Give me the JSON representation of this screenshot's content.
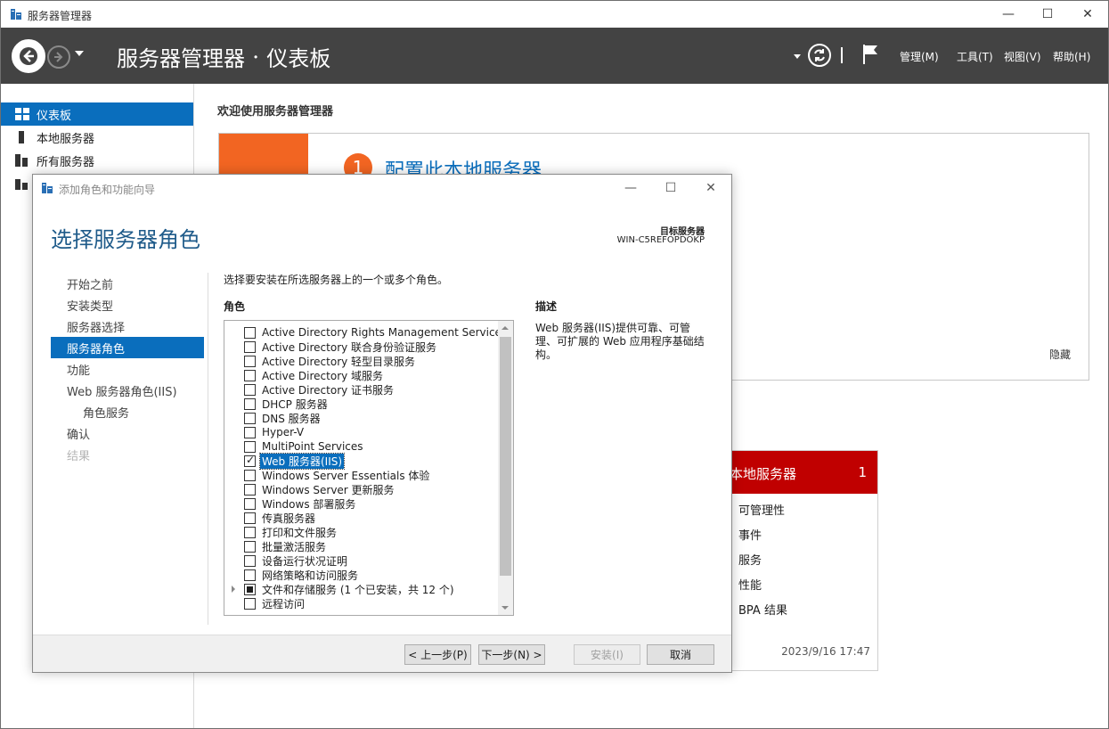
{
  "window": {
    "title": "服务器管理器",
    "minimize": "—",
    "maximize": "☐",
    "close": "✕"
  },
  "header": {
    "breadcrumb_root": "服务器管理器",
    "breadcrumb_sep": "•",
    "breadcrumb_current": "仪表板",
    "menus": [
      "管理(M)",
      "工具(T)",
      "视图(V)",
      "帮助(H)"
    ]
  },
  "nav": {
    "items": [
      {
        "label": "仪表板",
        "icon": "dashboard-icon",
        "active": true
      },
      {
        "label": "本地服务器",
        "icon": "server-icon"
      },
      {
        "label": "所有服务器",
        "icon": "servers-icon"
      }
    ]
  },
  "dashboard": {
    "title": "欢迎使用服务器管理器",
    "step_number": "1",
    "step_text": "配置此本地服务器",
    "hide_label": "隐藏",
    "tile": {
      "name": "本地服务器",
      "count": "1",
      "lines": [
        "可管理性",
        "事件",
        "服务",
        "性能",
        "BPA 结果"
      ],
      "timestamp": "2023/9/16 17:47"
    }
  },
  "wizard": {
    "title": "添加角色和功能向导",
    "heading": "选择服务器角色",
    "dest_label": "目标服务器",
    "dest_value": "WIN-C5REFOPDOKP",
    "steps": [
      {
        "label": "开始之前"
      },
      {
        "label": "安装类型"
      },
      {
        "label": "服务器选择"
      },
      {
        "label": "服务器角色",
        "active": true
      },
      {
        "label": "功能"
      },
      {
        "label": "Web 服务器角色(IIS)"
      },
      {
        "label": "角色服务",
        "indent": true
      },
      {
        "label": "确认"
      },
      {
        "label": "结果",
        "disabled": true
      }
    ],
    "instruction": "选择要安装在所选服务器上的一个或多个角色。",
    "roles_label": "角色",
    "roles": [
      {
        "label": "Active Directory Rights Management Services"
      },
      {
        "label": "Active Directory 联合身份验证服务"
      },
      {
        "label": "Active Directory 轻型目录服务"
      },
      {
        "label": "Active Directory 域服务"
      },
      {
        "label": "Active Directory 证书服务"
      },
      {
        "label": "DHCP 服务器"
      },
      {
        "label": "DNS 服务器"
      },
      {
        "label": "Hyper-V"
      },
      {
        "label": "MultiPoint Services"
      },
      {
        "label": "Web 服务器(IIS)",
        "checked": true,
        "selected": true
      },
      {
        "label": "Windows Server Essentials 体验"
      },
      {
        "label": "Windows Server 更新服务"
      },
      {
        "label": "Windows 部署服务"
      },
      {
        "label": "传真服务器"
      },
      {
        "label": "打印和文件服务"
      },
      {
        "label": "批量激活服务"
      },
      {
        "label": "设备运行状况证明"
      },
      {
        "label": "网络策略和访问服务"
      },
      {
        "label": "文件和存储服务 (1 个已安装，共 12 个)",
        "partial": true,
        "expandable": true
      },
      {
        "label": "远程访问"
      }
    ],
    "desc_label": "描述",
    "desc_text": "Web 服务器(IIS)提供可靠、可管理、可扩展的 Web 应用程序基础结构。",
    "buttons": {
      "prev": "< 上一步(P)",
      "next": "下一步(N) >",
      "install": "安装(I)",
      "cancel": "取消"
    }
  }
}
